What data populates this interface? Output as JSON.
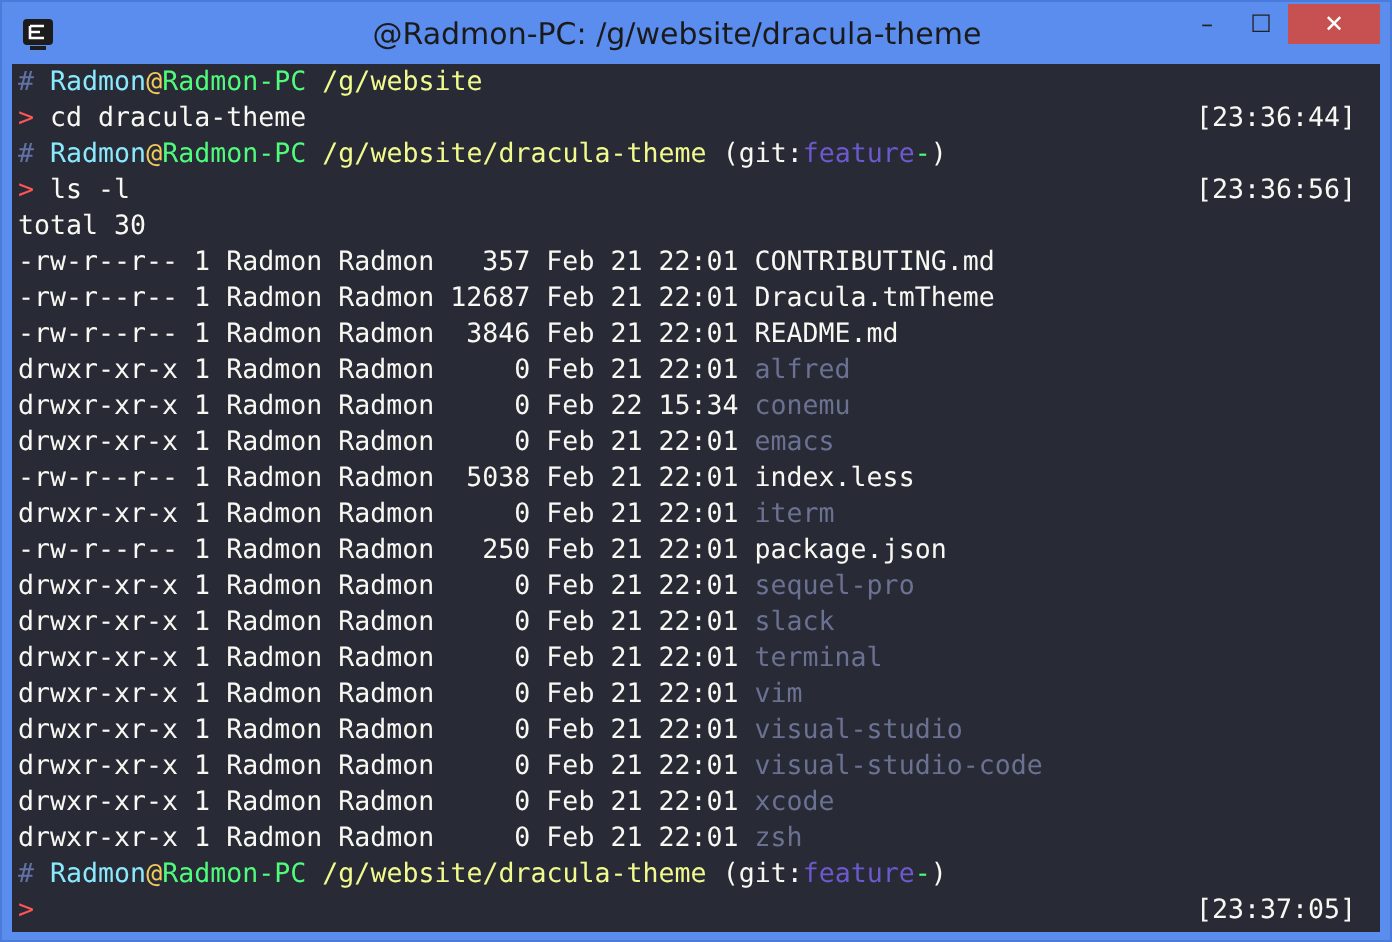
{
  "window": {
    "title": "@Radmon-PC: /g/website/dracula-theme",
    "controls": [
      "–",
      "☐",
      "✕"
    ]
  },
  "lines": [
    {
      "kind": "prompt",
      "segments": [
        {
          "kind": "hash",
          "text": "#"
        },
        {
          "kind": "user",
          "text": "Radmon"
        },
        {
          "kind": "at",
          "text": "@"
        },
        {
          "kind": "host",
          "text": "Radmon-PC"
        },
        {
          "kind": "path",
          "text": "/g/website"
        }
      ]
    },
    {
      "kind": "command",
      "marker": ">",
      "text": "cd dracula-theme",
      "time": "[23:36:44]"
    },
    {
      "kind": "prompt",
      "segments": [
        {
          "kind": "hash",
          "text": "#"
        },
        {
          "kind": "user",
          "text": "Radmon"
        },
        {
          "kind": "at",
          "text": "@"
        },
        {
          "kind": "host",
          "text": "Radmon-PC"
        },
        {
          "kind": "path",
          "text": "/g/website/dracula-theme"
        },
        {
          "kind": "plain",
          "text": "(git:"
        },
        {
          "kind": "branch",
          "text": "feature"
        },
        {
          "kind": "dirty",
          "text": "-"
        },
        {
          "kind": "plain",
          "text": ")"
        }
      ]
    },
    {
      "kind": "command",
      "marker": ">",
      "text": "ls -l",
      "time": "[23:36:56]"
    },
    {
      "kind": "output",
      "text": "total 30"
    },
    {
      "kind": "file",
      "meta": "-rw-r--r-- 1 Radmon Radmon   357 Feb 21 22:01",
      "name": "CONTRIBUTING.md",
      "directory": false
    },
    {
      "kind": "file",
      "meta": "-rw-r--r-- 1 Radmon Radmon 12687 Feb 21 22:01",
      "name": "Dracula.tmTheme",
      "directory": false
    },
    {
      "kind": "file",
      "meta": "-rw-r--r-- 1 Radmon Radmon  3846 Feb 21 22:01",
      "name": "README.md",
      "directory": false
    },
    {
      "kind": "file",
      "meta": "drwxr-xr-x 1 Radmon Radmon     0 Feb 21 22:01",
      "name": "alfred",
      "directory": true
    },
    {
      "kind": "file",
      "meta": "drwxr-xr-x 1 Radmon Radmon     0 Feb 22 15:34",
      "name": "conemu",
      "directory": true
    },
    {
      "kind": "file",
      "meta": "drwxr-xr-x 1 Radmon Radmon     0 Feb 21 22:01",
      "name": "emacs",
      "directory": true
    },
    {
      "kind": "file",
      "meta": "-rw-r--r-- 1 Radmon Radmon  5038 Feb 21 22:01",
      "name": "index.less",
      "directory": false
    },
    {
      "kind": "file",
      "meta": "drwxr-xr-x 1 Radmon Radmon     0 Feb 21 22:01",
      "name": "iterm",
      "directory": true
    },
    {
      "kind": "file",
      "meta": "-rw-r--r-- 1 Radmon Radmon   250 Feb 21 22:01",
      "name": "package.json",
      "directory": false
    },
    {
      "kind": "file",
      "meta": "drwxr-xr-x 1 Radmon Radmon     0 Feb 21 22:01",
      "name": "sequel-pro",
      "directory": true
    },
    {
      "kind": "file",
      "meta": "drwxr-xr-x 1 Radmon Radmon     0 Feb 21 22:01",
      "name": "slack",
      "directory": true
    },
    {
      "kind": "file",
      "meta": "drwxr-xr-x 1 Radmon Radmon     0 Feb 21 22:01",
      "name": "terminal",
      "directory": true
    },
    {
      "kind": "file",
      "meta": "drwxr-xr-x 1 Radmon Radmon     0 Feb 21 22:01",
      "name": "vim",
      "directory": true
    },
    {
      "kind": "file",
      "meta": "drwxr-xr-x 1 Radmon Radmon     0 Feb 21 22:01",
      "name": "visual-studio",
      "directory": true
    },
    {
      "kind": "file",
      "meta": "drwxr-xr-x 1 Radmon Radmon     0 Feb 21 22:01",
      "name": "visual-studio-code",
      "directory": true
    },
    {
      "kind": "file",
      "meta": "drwxr-xr-x 1 Radmon Radmon     0 Feb 21 22:01",
      "name": "xcode",
      "directory": true
    },
    {
      "kind": "file",
      "meta": "drwxr-xr-x 1 Radmon Radmon     0 Feb 21 22:01",
      "name": "zsh",
      "directory": true
    },
    {
      "kind": "prompt",
      "segments": [
        {
          "kind": "hash",
          "text": "#"
        },
        {
          "kind": "user",
          "text": "Radmon"
        },
        {
          "kind": "at",
          "text": "@"
        },
        {
          "kind": "host",
          "text": "Radmon-PC"
        },
        {
          "kind": "path",
          "text": "/g/website/dracula-theme"
        },
        {
          "kind": "plain",
          "text": "(git:"
        },
        {
          "kind": "branch",
          "text": "feature"
        },
        {
          "kind": "dirty",
          "text": "-"
        },
        {
          "kind": "plain",
          "text": ")"
        }
      ]
    },
    {
      "kind": "command",
      "marker": ">",
      "time": "[23:37:05]"
    }
  ]
}
